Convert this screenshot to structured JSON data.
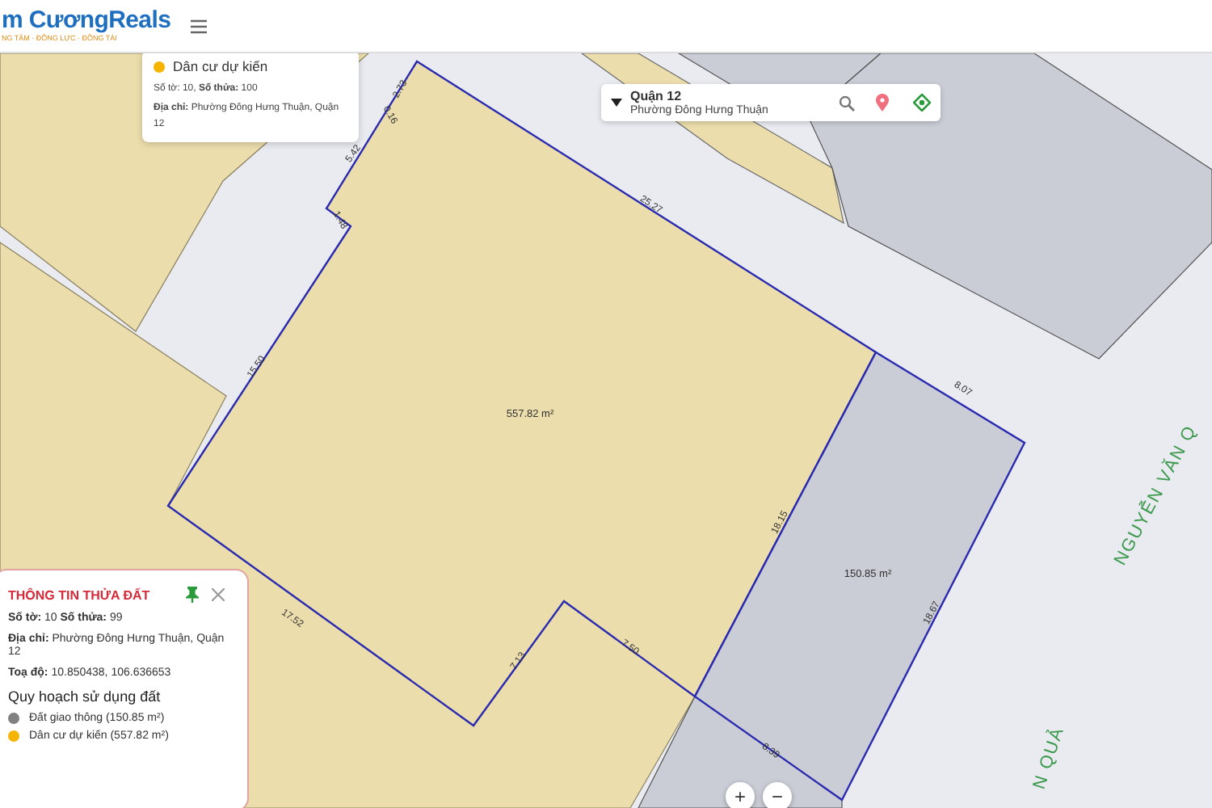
{
  "header": {
    "logo": "m CươngReals",
    "tagline": "NG TÂM · ĐỒNG LỰC · ĐỒNG TÀI"
  },
  "map": {
    "parcels": [
      {
        "area": "557.82 m²",
        "kind": "residential"
      },
      {
        "area": "150.85 m²",
        "kind": "road"
      }
    ],
    "edge_lengths": [
      "2.73",
      "0.16",
      "5.42",
      "1.48",
      "15.50",
      "25.27",
      "8.07",
      "18.15",
      "18.67",
      "17.52",
      "7.13",
      "7.50",
      "8.39"
    ],
    "road_labels": [
      "NGUYỄN VĂN Q",
      "N QUẢ"
    ]
  },
  "map_popup": {
    "title": "Dân cư dự kiến",
    "color": "#f5b400",
    "lines": [
      "Số tờ: 10, **Số thửa:** 100",
      "**Địa chỉ:** Phường Đông Hưng Thuận, Quận 12"
    ]
  },
  "location_bar": {
    "district": "Quận 12",
    "ward": "Phường Đông Hưng Thuận"
  },
  "info_panel": {
    "title": "THÔNG TIN THỬA ĐẤT",
    "fields": [
      "**Số tờ:** 10 **Số thửa:** 99",
      "**Địa chỉ:** Phường Đông Hưng Thuận, Quận 12",
      "**Toạ độ:** 10.850438, 106.636653"
    ],
    "section_title": "Quy hoạch sử dụng đất",
    "legend": [
      {
        "label": "Đất giao thông (150.85 m²)",
        "color": "#808080"
      },
      {
        "label": "Dân cư dự kiến (557.82 m²)",
        "color": "#f5b400"
      }
    ]
  },
  "zoom_controls": [
    "+",
    "−"
  ]
}
